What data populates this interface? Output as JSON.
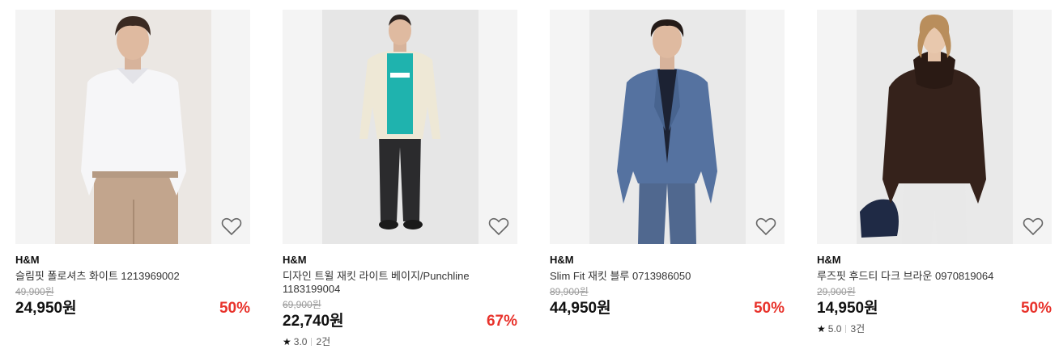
{
  "products": [
    {
      "brand": "H&M",
      "name": "슬림핏 폴로셔츠 화이트 1213969002",
      "original_price": "49,900원",
      "price": "24,950원",
      "discount": "50%",
      "image": "man-white-polo",
      "colors": {
        "top": "#f6f6f8",
        "bottom": "#c2a58d",
        "bg": "#ebe7e3"
      }
    },
    {
      "brand": "H&M",
      "name": "디자인 트윌 재킷 라이트 베이지/Punchline 1183199004",
      "original_price": "69,900원",
      "price": "22,740원",
      "discount": "67%",
      "rating": "3.0",
      "review_count": "2건",
      "image": "man-beige-jacket",
      "colors": {
        "top": "#eee8d6",
        "bottom": "#2b2b2d",
        "bg": "#e6e6e6"
      }
    },
    {
      "brand": "H&M",
      "name": "Slim Fit 재킷 블루 0713986050",
      "original_price": "89,900원",
      "price": "44,950원",
      "discount": "50%",
      "image": "man-blue-suit",
      "colors": {
        "top": "#5572a0",
        "bottom": "#50688f",
        "bg": "#e9e9e9"
      }
    },
    {
      "brand": "H&M",
      "name": "루즈핏 후드티 다크 브라운 0970819064",
      "original_price": "29,900원",
      "price": "14,950원",
      "discount": "50%",
      "rating": "5.0",
      "review_count": "3건",
      "image": "man-brown-hoodie",
      "colors": {
        "top": "#35221b",
        "bottom": "#e8e8e8",
        "bg": "#e9e9e9"
      }
    }
  ],
  "icons": {
    "wishlist": "heart-outline-icon",
    "rating": "star-icon"
  }
}
